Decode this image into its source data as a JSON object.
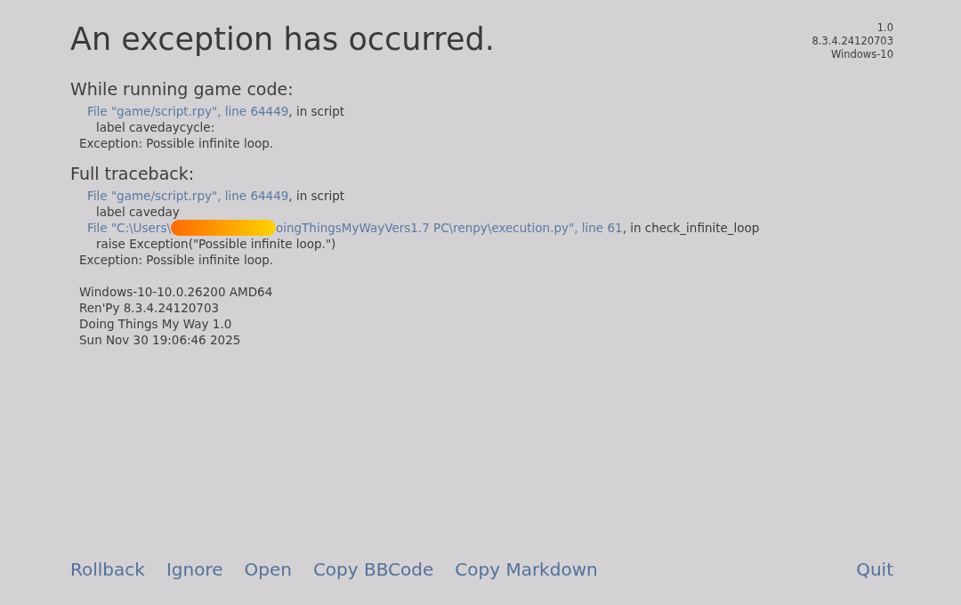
{
  "title": "An exception has occurred.",
  "version_info": [
    "1.0",
    "8.3.4.24120703",
    "Windows-10"
  ],
  "sections": [
    {
      "heading": "While running game code:",
      "frames": [
        {
          "location": [
            "File \"game/script.rpy\", line 64449"
          ],
          "context": ", in script",
          "code": "label cavedaycycle:"
        }
      ],
      "exception": "Exception: Possible infinite loop."
    },
    {
      "heading": "Full traceback:",
      "frames": [
        {
          "location": [
            "File \"game/script.rpy\", line 64449"
          ],
          "context": ", in script",
          "code": "label caveday"
        },
        {
          "location": [
            "File \"C:\\Users\\",
            "oingThingsMyWayVers1.7 PC\\renpy\\execution.py\", line 61"
          ],
          "context": ", in check_infinite_loop",
          "code": "raise Exception(\"Possible infinite loop.\")"
        }
      ],
      "exception": "Exception: Possible infinite loop."
    }
  ],
  "system_info": [
    "Windows-10-10.0.26200 AMD64",
    "Ren'Py 8.3.4.24120703",
    "Doing Things My Way 1.0",
    "Sun Nov 30 19:06:46 2025"
  ],
  "actions": [
    "Rollback",
    "Ignore",
    "Open",
    "Copy BBCode",
    "Copy Markdown"
  ],
  "quit": "Quit"
}
